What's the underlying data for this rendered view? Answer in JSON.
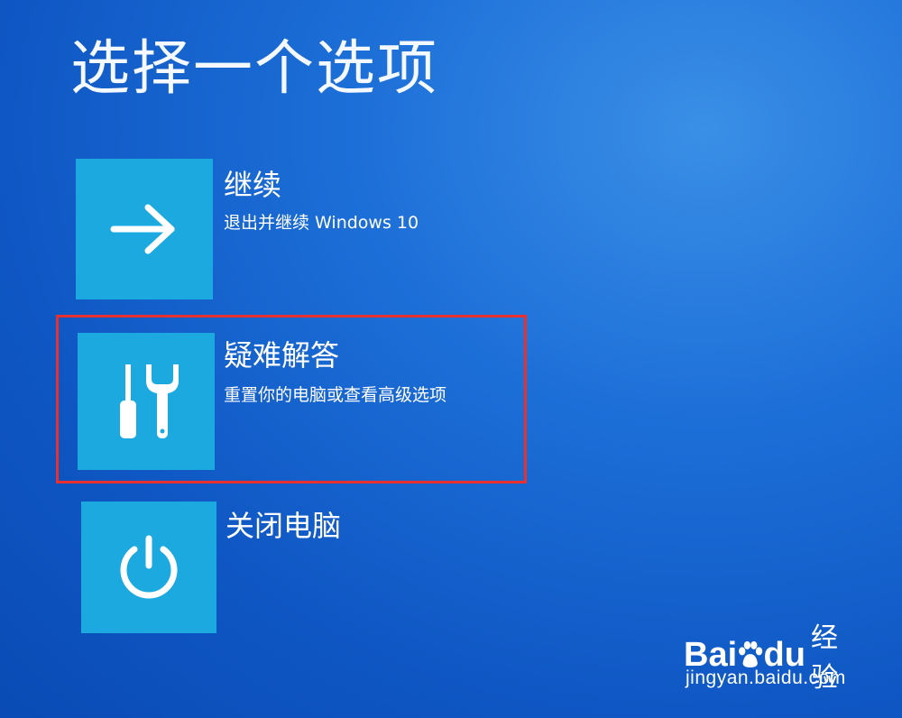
{
  "screen": {
    "title": "选择一个选项"
  },
  "options": [
    {
      "title": "继续",
      "description": "退出并继续 Windows 10",
      "icon": "arrow-right-icon"
    },
    {
      "title": "疑难解答",
      "description": "重置你的电脑或查看高级选项",
      "icon": "tools-icon",
      "highlighted": true
    },
    {
      "title": "关闭电脑",
      "description": "",
      "icon": "power-icon"
    }
  ],
  "watermark": {
    "brand_left": "Bai",
    "brand_right": "du",
    "product": "经验",
    "url": "jingyan.baidu.com"
  },
  "colors": {
    "background": "#1565d0",
    "tile": "#1ba9e0",
    "highlight": "#e8302f"
  }
}
